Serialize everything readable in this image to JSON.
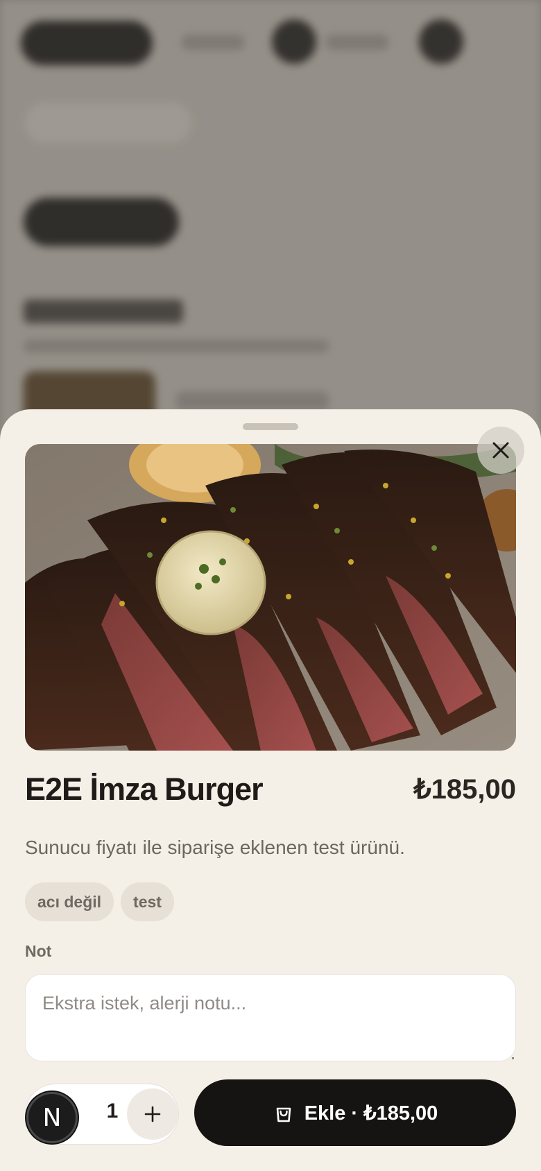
{
  "product": {
    "name": "E2E İmza Burger",
    "price": "₺185,00",
    "description": "Sunucu fiyatı ile siparişe eklenen test ürünü.",
    "tags": [
      "acı değil",
      "test"
    ],
    "image_icon": "steak-photo"
  },
  "note": {
    "label": "Not",
    "placeholder": "Ekstra istek, alerji notu..."
  },
  "quantity": {
    "value": "1",
    "plus_icon": "plus-icon"
  },
  "add_button": {
    "label": "Ekle · ₺185,00",
    "icon": "shopping-bag-icon"
  },
  "badge": {
    "letter": "N"
  },
  "colors": {
    "sheet_bg": "#f5f0e7",
    "button_dark": "#151412",
    "tag_bg": "#e6e0d7"
  }
}
